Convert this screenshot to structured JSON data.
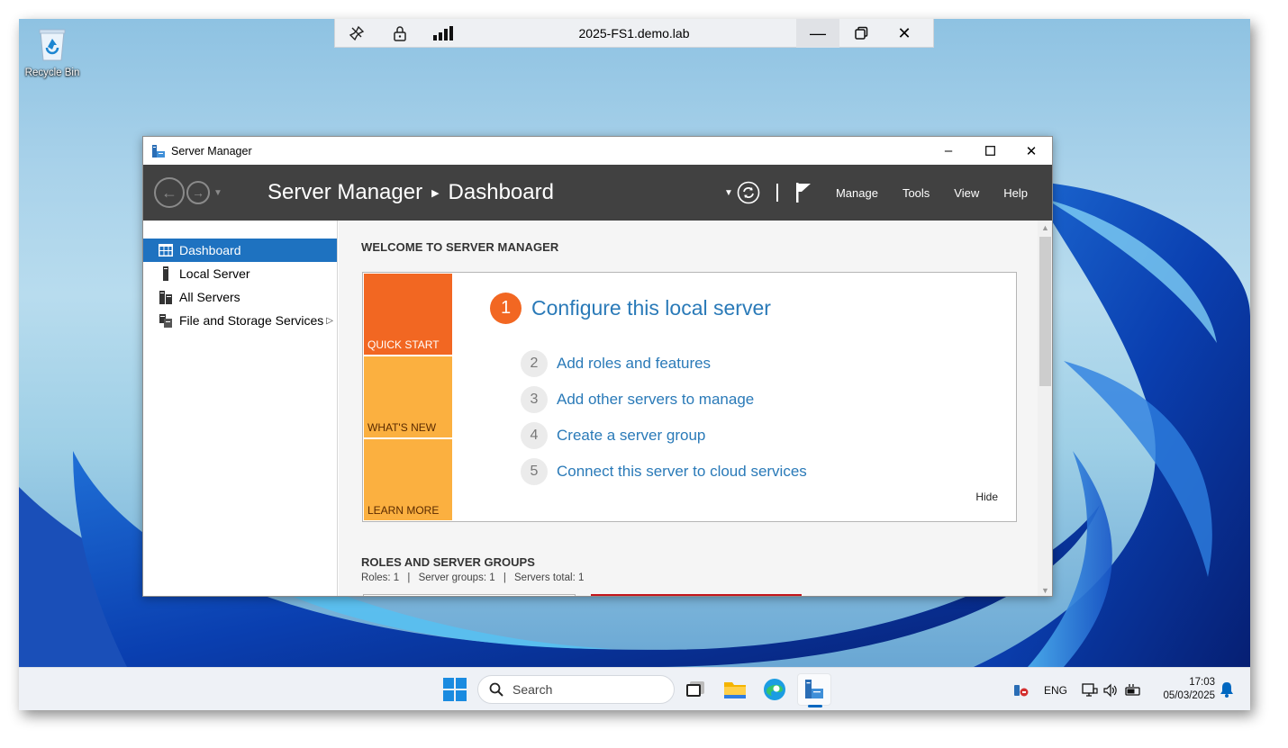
{
  "rdp": {
    "title": "2025-FS1.demo.lab",
    "icons": [
      "pin-icon",
      "lock-icon",
      "signal-bars-icon"
    ],
    "window_controls": [
      "minimize-icon",
      "restore-icon",
      "close-icon"
    ]
  },
  "desktop": {
    "recycle_bin_label": "Recycle Bin"
  },
  "server_manager": {
    "window_title": "Server Manager",
    "breadcrumb": {
      "root": "Server Manager",
      "current": "Dashboard"
    },
    "menus": [
      "Manage",
      "Tools",
      "View",
      "Help"
    ],
    "nav": [
      {
        "label": "Dashboard",
        "icon": "dashboard-grid-icon",
        "active": true
      },
      {
        "label": "Local Server",
        "icon": "server-icon",
        "active": false
      },
      {
        "label": "All Servers",
        "icon": "servers-icon",
        "active": false
      },
      {
        "label": "File and Storage Services",
        "icon": "storage-icon",
        "active": false,
        "has_submenu": true
      }
    ],
    "welcome": {
      "heading": "WELCOME TO SERVER MANAGER",
      "tiles": [
        "QUICK START",
        "WHAT'S NEW",
        "LEARN MORE"
      ],
      "primary_step": {
        "number": "1",
        "label": "Configure this local server"
      },
      "steps": [
        {
          "number": "2",
          "label": "Add roles and features"
        },
        {
          "number": "3",
          "label": "Add other servers to manage"
        },
        {
          "number": "4",
          "label": "Create a server group"
        },
        {
          "number": "5",
          "label": "Connect this server to cloud services"
        }
      ],
      "hide_label": "Hide"
    },
    "roles": {
      "heading": "ROLES AND SERVER GROUPS",
      "roles_text": "Roles: 1",
      "groups_text": "Server groups: 1",
      "servers_text": "Servers total: 1",
      "separator": "|"
    }
  },
  "taskbar": {
    "search_placeholder": "Search",
    "language": "ENG",
    "time": "17:03",
    "date": "05/03/2025"
  },
  "colors": {
    "accent_blue": "#1e72c0",
    "quick_start_orange": "#f26722",
    "tile_yellow": "#fbb040",
    "link_blue": "#2a7ab8",
    "header_dark": "#414141"
  }
}
